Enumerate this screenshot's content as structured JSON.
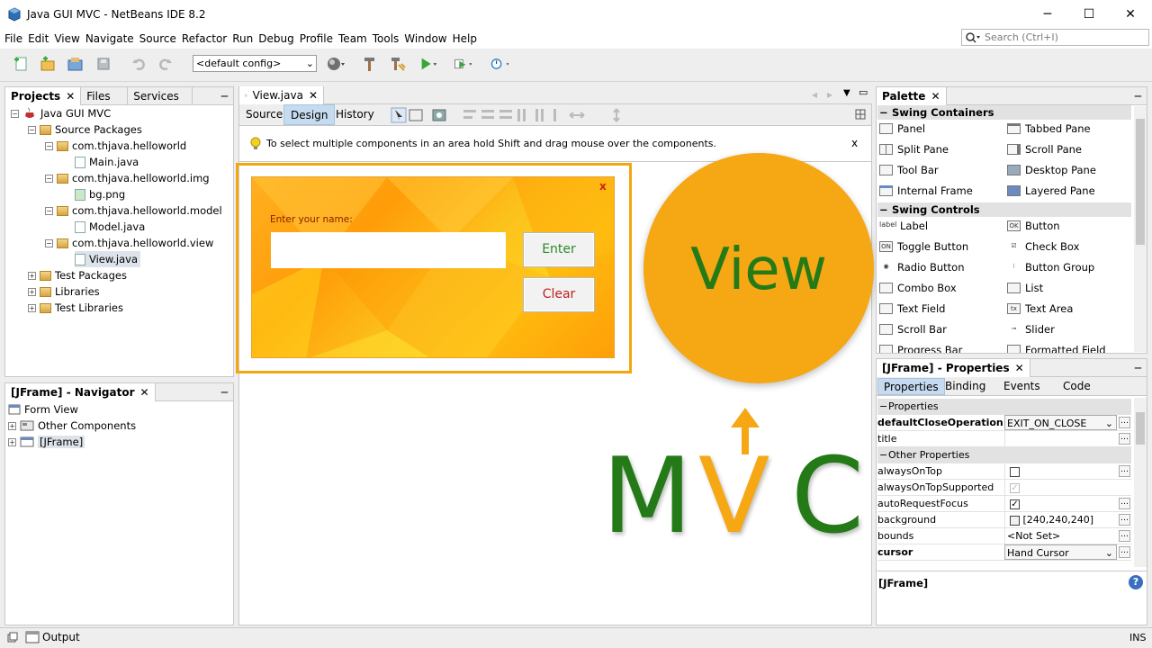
{
  "window": {
    "title": "Java GUI MVC - NetBeans IDE 8.2",
    "minimize": "─",
    "maximize": "☐",
    "close": "✕"
  },
  "menu": [
    "File",
    "Edit",
    "View",
    "Navigate",
    "Source",
    "Refactor",
    "Run",
    "Debug",
    "Profile",
    "Team",
    "Tools",
    "Window",
    "Help"
  ],
  "search": {
    "placeholder": "Search (Ctrl+I)"
  },
  "toolbar": {
    "config": "<default config>"
  },
  "projects": {
    "tabs": [
      "Projects",
      "Files",
      "Services"
    ],
    "tree": [
      "Java GUI MVC",
      "Source Packages",
      "com.thjava.helloworld",
      "Main.java",
      "com.thjava.helloworld.img",
      "bg.png",
      "com.thjava.helloworld.model",
      "Model.java",
      "com.thjava.helloworld.view",
      "View.java",
      "Test Packages",
      "Libraries",
      "Test Libraries"
    ]
  },
  "navigator": {
    "title": "[JFrame] - Navigator",
    "tree": [
      "Form View",
      "Other Components",
      "[JFrame]"
    ]
  },
  "editor": {
    "tab": "View.java",
    "modes": [
      "Source",
      "Design",
      "History"
    ],
    "hint": "To select multiple components in an area hold Shift and drag mouse over the components.",
    "hint_close": "x"
  },
  "form": {
    "close": "x",
    "label": "Enter your name:",
    "enter": "Enter",
    "clear": "Clear"
  },
  "overlay": {
    "view": "View",
    "m": "M",
    "v": "V",
    "c": "C"
  },
  "palette": {
    "title": "Palette",
    "containers_header": "Swing Containers",
    "containers": [
      "Panel",
      "Tabbed Pane",
      "Split Pane",
      "Scroll Pane",
      "Tool Bar",
      "Desktop Pane",
      "Internal Frame",
      "Layered Pane"
    ],
    "controls_header": "Swing Controls",
    "controls": [
      "Label",
      "Button",
      "Toggle Button",
      "Check Box",
      "Radio Button",
      "Button Group",
      "Combo Box",
      "List",
      "Text Field",
      "Text Area",
      "Scroll Bar",
      "Slider",
      "Progress Bar",
      "Formatted Field"
    ],
    "icon_label": "label",
    "icon_ok": "OK",
    "icon_on": "ON",
    "icon_tx": "tx"
  },
  "properties": {
    "title": "[JFrame] - Properties",
    "tabs": [
      "Properties",
      "Binding",
      "Events",
      "Code"
    ],
    "section1": "Properties",
    "section2": "Other Properties",
    "rows": [
      {
        "key": "defaultCloseOperation",
        "value": "EXIT_ON_CLOSE",
        "bold": true
      },
      {
        "key": "title",
        "value": ""
      },
      {
        "key": "alwaysOnTop",
        "value": ""
      },
      {
        "key": "alwaysOnTopSupported",
        "value": ""
      },
      {
        "key": "autoRequestFocus",
        "value": ""
      },
      {
        "key": "background",
        "value": "[240,240,240]"
      },
      {
        "key": "bounds",
        "value": "<Not Set>"
      },
      {
        "key": "cursor",
        "value": "Hand Cursor",
        "bold": true
      }
    ],
    "footer": "[JFrame]",
    "help": "?"
  },
  "statusbar": {
    "output": "Output",
    "mode": "INS"
  }
}
